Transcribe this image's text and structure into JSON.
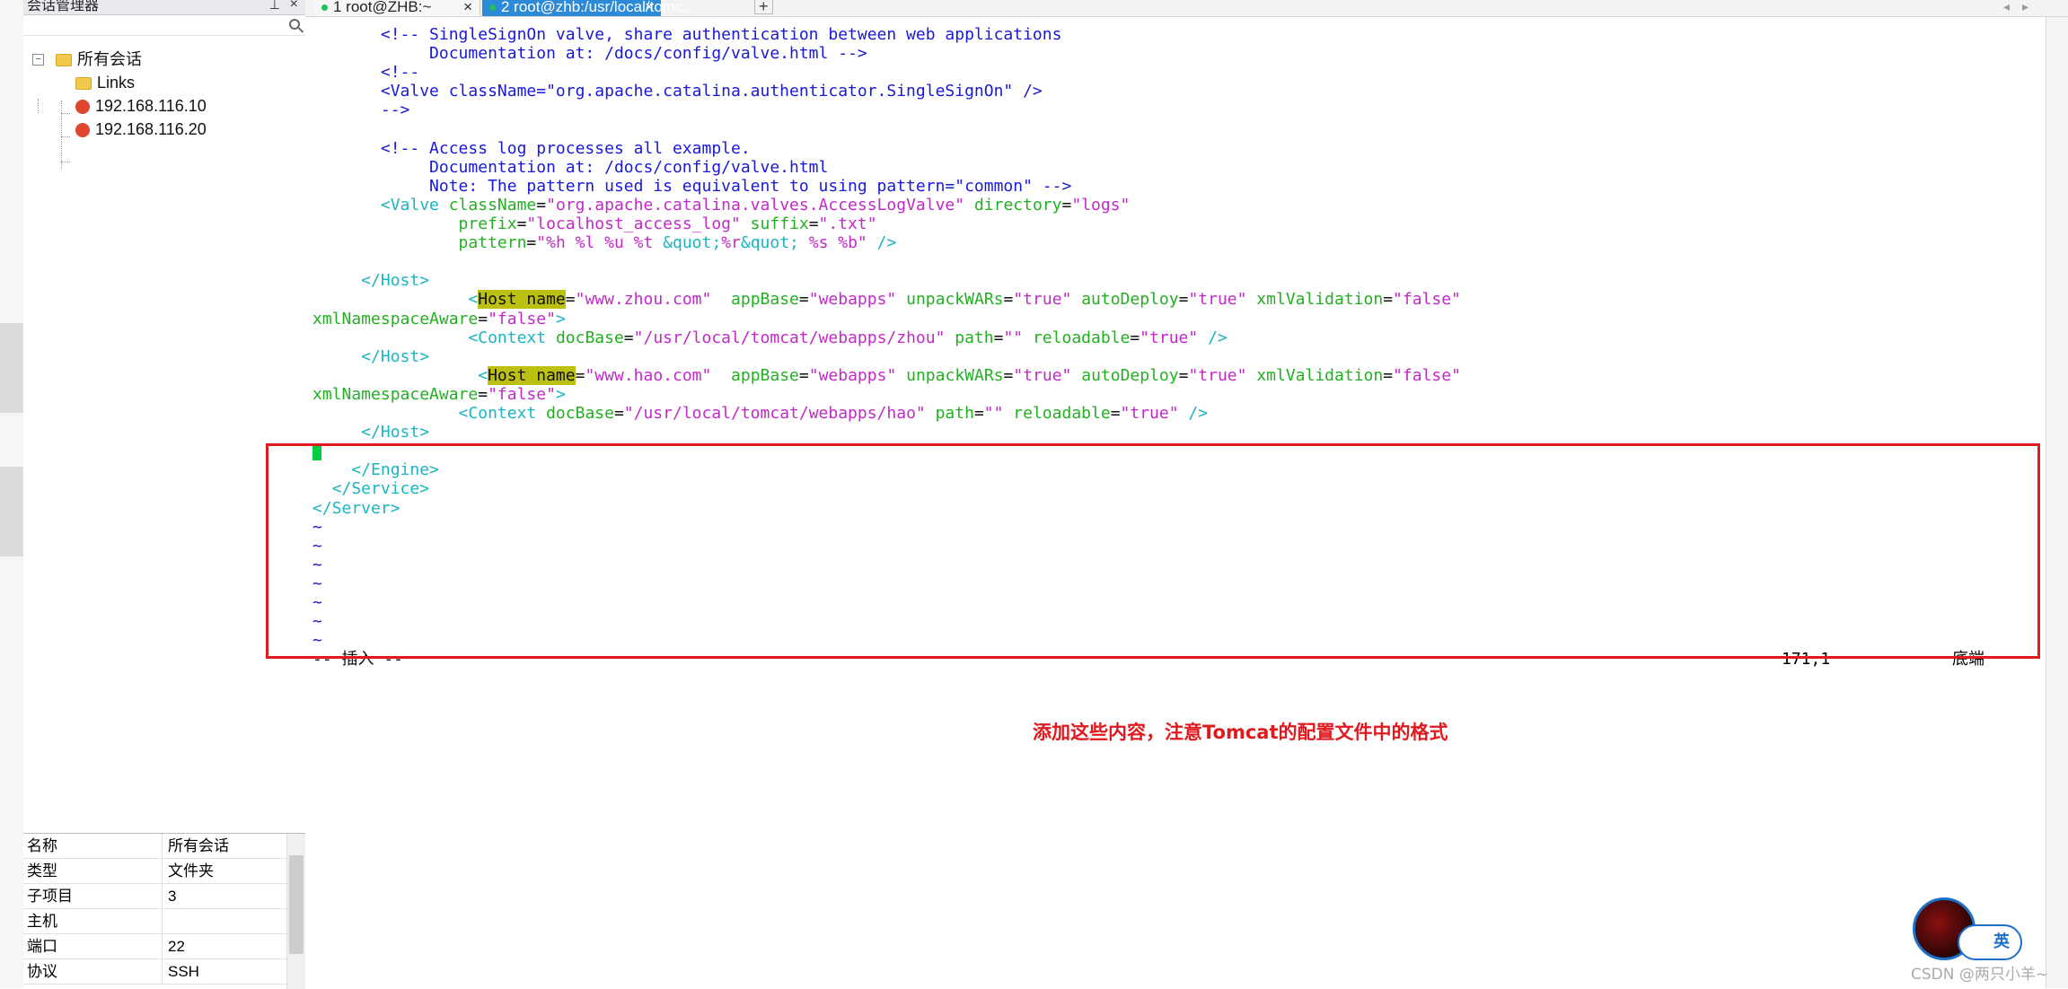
{
  "sessions_panel": {
    "title": "会话管理器",
    "root": "所有会话",
    "items": [
      "Links",
      "192.168.116.10",
      "192.168.116.20"
    ]
  },
  "properties": [
    {
      "key": "名称",
      "value": "所有会话"
    },
    {
      "key": "类型",
      "value": "文件夹"
    },
    {
      "key": "子项目",
      "value": "3"
    },
    {
      "key": "主机",
      "value": ""
    },
    {
      "key": "端口",
      "value": "22"
    },
    {
      "key": "协议",
      "value": "SSH"
    }
  ],
  "tabs": [
    {
      "label": "1 root@ZHB:~",
      "active": false
    },
    {
      "label": "2 root@zhb:/usr/local/tomc...",
      "active": true
    }
  ],
  "editor": {
    "lines": [
      [
        [
          "b",
          "       <!-- SingleSignOn valve, share authentication between web applications"
        ]
      ],
      [
        [
          "b",
          "            Documentation at: /docs/config/valve.html -->"
        ]
      ],
      [
        [
          "b",
          "       <!--"
        ]
      ],
      [
        [
          "b",
          "       <Valve className=\"org.apache.catalina.authenticator.SingleSignOn\" />"
        ]
      ],
      [
        [
          "b",
          "       -->"
        ]
      ],
      [
        [
          "k",
          ""
        ]
      ],
      [
        [
          "b",
          "       <!-- Access log processes all example."
        ]
      ],
      [
        [
          "b",
          "            Documentation at: /docs/config/valve.html"
        ]
      ],
      [
        [
          "b",
          "            Note: The pattern used is equivalent to using pattern=\"common\" -->"
        ]
      ],
      [
        [
          "c",
          "       <Valve "
        ],
        [
          "g",
          "className"
        ],
        [
          "k",
          "="
        ],
        [
          "m",
          "\"org.apache.catalina.valves.AccessLogValve\""
        ],
        [
          "g",
          " directory"
        ],
        [
          "k",
          "="
        ],
        [
          "m",
          "\"logs\""
        ]
      ],
      [
        [
          "g",
          "               prefix"
        ],
        [
          "k",
          "="
        ],
        [
          "m",
          "\"localhost_access_log\""
        ],
        [
          "g",
          " suffix"
        ],
        [
          "k",
          "="
        ],
        [
          "m",
          "\".txt\""
        ]
      ],
      [
        [
          "g",
          "               pattern"
        ],
        [
          "k",
          "="
        ],
        [
          "m",
          "\"%h %l %u %t "
        ],
        [
          "c",
          "&quot;"
        ],
        [
          "m",
          "%r"
        ],
        [
          "c",
          "&quot;"
        ],
        [
          "m",
          " %s %b\""
        ],
        [
          "c",
          " />"
        ]
      ],
      [
        [
          "k",
          ""
        ]
      ],
      [
        [
          "c",
          "     </Host>"
        ]
      ],
      [
        [
          "c",
          "                "
        ],
        [
          "c",
          "<"
        ],
        [
          "hl",
          "Host name"
        ],
        [
          "k",
          "="
        ],
        [
          "m",
          "\"www.zhou.com\""
        ],
        [
          "g",
          "  appBase"
        ],
        [
          "k",
          "="
        ],
        [
          "m",
          "\"webapps\""
        ],
        [
          "g",
          " unpackWARs"
        ],
        [
          "k",
          "="
        ],
        [
          "m",
          "\"true\""
        ],
        [
          "g",
          " autoDeploy"
        ],
        [
          "k",
          "="
        ],
        [
          "m",
          "\"true\""
        ],
        [
          "g",
          " xmlValidation"
        ],
        [
          "k",
          "="
        ],
        [
          "m",
          "\"false\""
        ]
      ],
      [
        [
          "g",
          "xmlNamespaceAware"
        ],
        [
          "k",
          "="
        ],
        [
          "m",
          "\"false\""
        ],
        [
          "c",
          ">"
        ]
      ],
      [
        [
          "c",
          "                <Context "
        ],
        [
          "g",
          "docBase"
        ],
        [
          "k",
          "="
        ],
        [
          "m",
          "\"/usr/local/tomcat/webapps/zhou\""
        ],
        [
          "g",
          " path"
        ],
        [
          "k",
          "="
        ],
        [
          "m",
          "\"\""
        ],
        [
          "g",
          " reloadable"
        ],
        [
          "k",
          "="
        ],
        [
          "m",
          "\"true\""
        ],
        [
          "c",
          " />"
        ]
      ],
      [
        [
          "c",
          "     </Host>"
        ]
      ],
      [
        [
          "c",
          "                 <"
        ],
        [
          "hl",
          "Host name"
        ],
        [
          "k",
          "="
        ],
        [
          "m",
          "\"www.hao.com\""
        ],
        [
          "g",
          "  appBase"
        ],
        [
          "k",
          "="
        ],
        [
          "m",
          "\"webapps\""
        ],
        [
          "g",
          " unpackWARs"
        ],
        [
          "k",
          "="
        ],
        [
          "m",
          "\"true\""
        ],
        [
          "g",
          " autoDeploy"
        ],
        [
          "k",
          "="
        ],
        [
          "m",
          "\"true\""
        ],
        [
          "g",
          " xmlValidation"
        ],
        [
          "k",
          "="
        ],
        [
          "m",
          "\"false\""
        ]
      ],
      [
        [
          "g",
          "xmlNamespaceAware"
        ],
        [
          "k",
          "="
        ],
        [
          "m",
          "\"false\""
        ],
        [
          "c",
          ">"
        ]
      ],
      [
        [
          "c",
          "               <Context "
        ],
        [
          "g",
          "docBase"
        ],
        [
          "k",
          "="
        ],
        [
          "m",
          "\"/usr/local/tomcat/webapps/hao\""
        ],
        [
          "g",
          " path"
        ],
        [
          "k",
          "="
        ],
        [
          "m",
          "\"\""
        ],
        [
          "g",
          " reloadable"
        ],
        [
          "k",
          "="
        ],
        [
          "m",
          "\"true\""
        ],
        [
          "c",
          " />"
        ]
      ],
      [
        [
          "c",
          "     </Host>"
        ]
      ],
      [
        [
          "cursor",
          ""
        ]
      ],
      [
        [
          "c",
          "    </Engine>"
        ]
      ],
      [
        [
          "c",
          "  </Service>"
        ]
      ],
      [
        [
          "c",
          "</Server>"
        ]
      ],
      [
        [
          "b",
          "~"
        ]
      ],
      [
        [
          "b",
          "~"
        ]
      ],
      [
        [
          "b",
          "~"
        ]
      ],
      [
        [
          "b",
          "~"
        ]
      ],
      [
        [
          "b",
          "~"
        ]
      ],
      [
        [
          "b",
          "~"
        ]
      ],
      [
        [
          "b",
          "~"
        ]
      ],
      [
        [
          "k",
          "-- 插入 --"
        ]
      ]
    ],
    "status_position": "171,1",
    "status_scroll": "底端"
  },
  "annotation": "添加这些内容，注意Tomcat的配置文件中的格式",
  "ime_label": "英",
  "watermark": "CSDN @两只小羊~"
}
